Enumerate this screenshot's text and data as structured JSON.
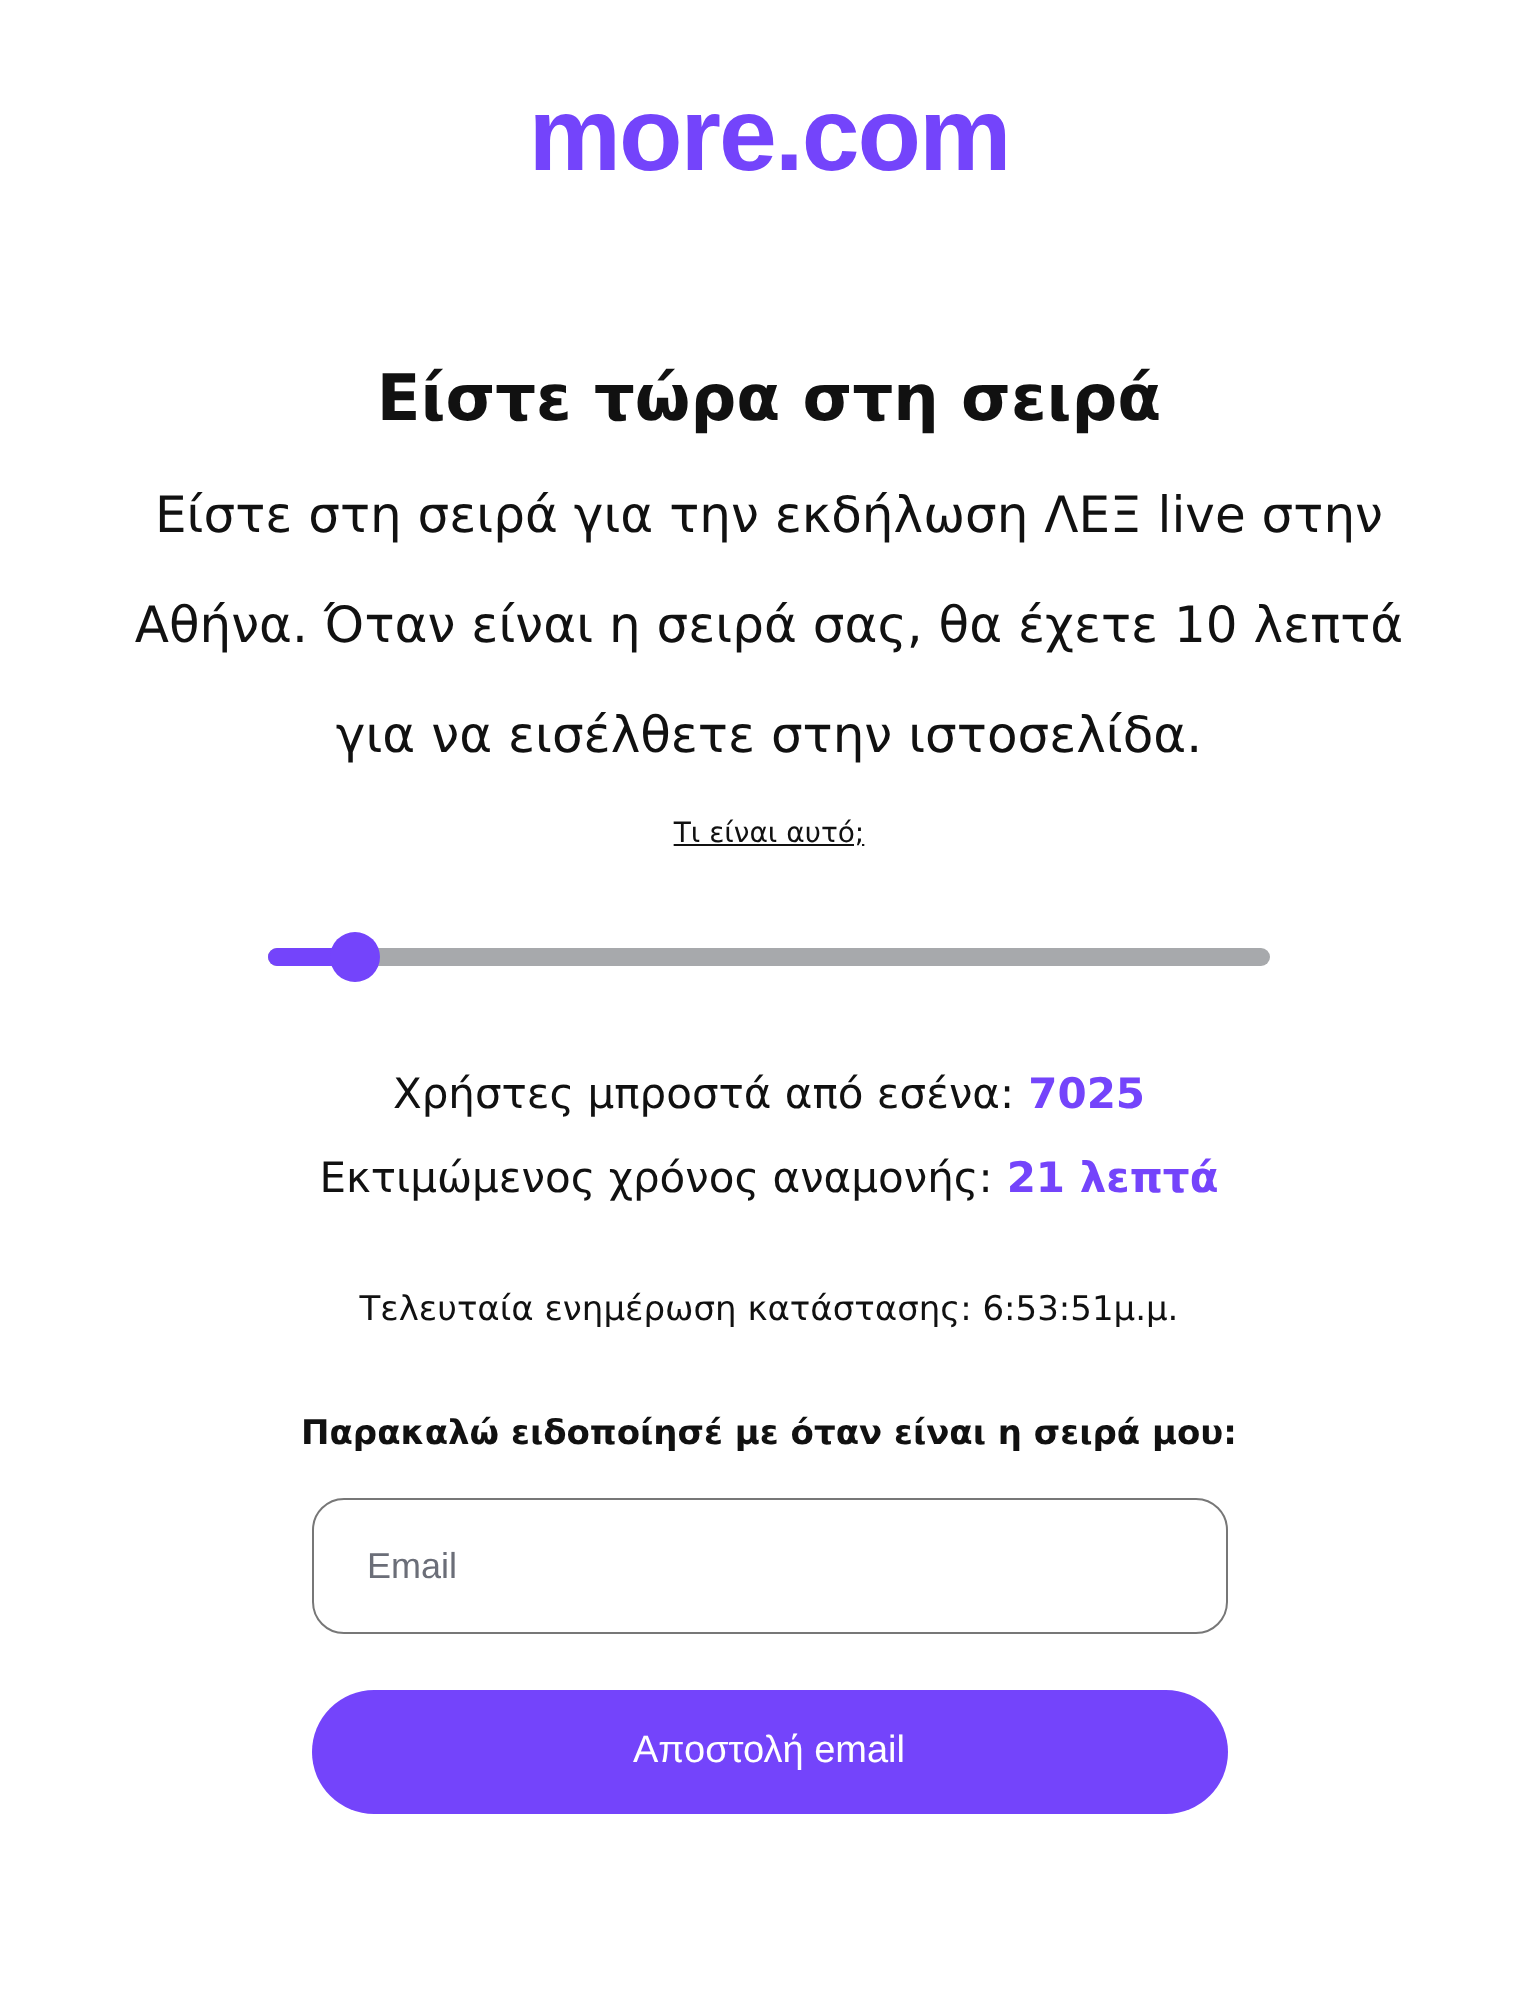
{
  "logo": "more.com",
  "title": "Είστε τώρα στη σειρά",
  "message": "Είστε στη σειρά για την εκδήλωση ΛΕΞ live στην Αθήνα.  Όταν είναι η σειρά σας, θα έχετε 10 λεπτά για να εισέλθετε στην ιστοσελίδα.",
  "info_link": "Τι είναι αυτό;",
  "progress": {
    "level": 0.085
  },
  "stats": [
    {
      "label": "Χρήστες μπροστά από εσένα:",
      "value": "7025"
    },
    {
      "label": "Εκτιμώμενος χρόνος αναμονής:",
      "value": "21 λεπτά"
    }
  ],
  "last_update": "Τελευταία ενημέρωση κατάστασης: 6:53:51μ.μ.",
  "notify": {
    "prompt": "Παρακαλώ ειδοποίησέ με όταν είναι η σειρά μου:",
    "placeholder": "Email",
    "button": "Αποστολή email"
  }
}
